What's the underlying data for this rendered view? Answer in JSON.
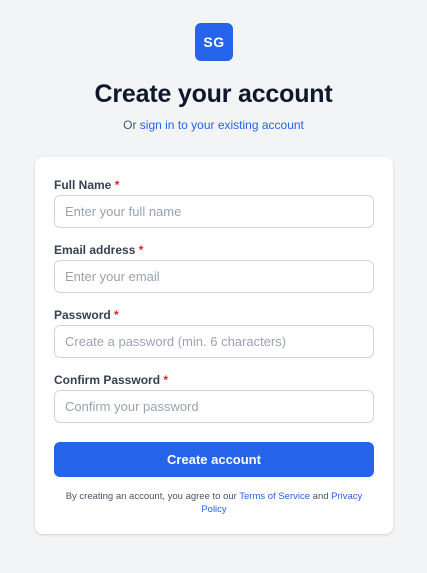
{
  "logo": {
    "text": "SG"
  },
  "header": {
    "title": "Create your account",
    "subtitle_prefix": "Or",
    "signin_link": "sign in to your existing account"
  },
  "form": {
    "required_marker": "*",
    "fields": [
      {
        "label": "Full Name",
        "placeholder": "Enter your full name",
        "value": ""
      },
      {
        "label": "Email address",
        "placeholder": "Enter your email",
        "value": ""
      },
      {
        "label": "Password",
        "placeholder": "Create a password (min. 6 characters)",
        "value": ""
      },
      {
        "label": "Confirm Password",
        "placeholder": "Confirm your password",
        "value": ""
      }
    ],
    "submit_label": "Create account"
  },
  "terms": {
    "prefix": "By creating an account, you agree to our",
    "terms_link": "Terms of Service",
    "and": "and",
    "privacy_link": "Privacy Policy"
  },
  "colors": {
    "accent": "#2563eb",
    "required": "#dc2626",
    "background": "#f3f4f6"
  }
}
